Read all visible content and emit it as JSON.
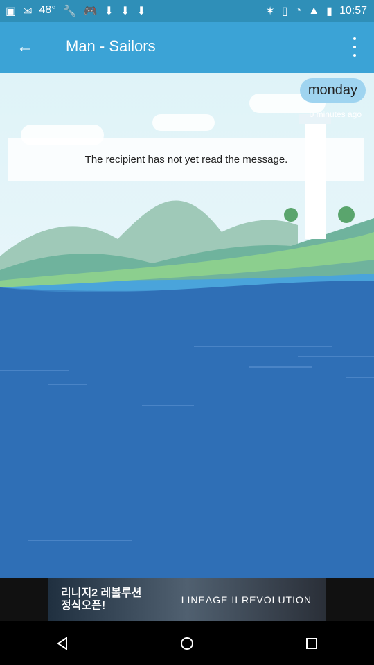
{
  "status": {
    "time": "10:57",
    "signal": "48°"
  },
  "app": {
    "title": "Man - Sailors"
  },
  "message": {
    "bubble": "monday",
    "time_ago": "0 minutes ago",
    "notice": "The recipient has not yet read the message."
  },
  "ad": {
    "left_text": "리니지2 레볼루션\n정식오픈!",
    "right_text": "LINEAGE II REVOLUTION"
  }
}
